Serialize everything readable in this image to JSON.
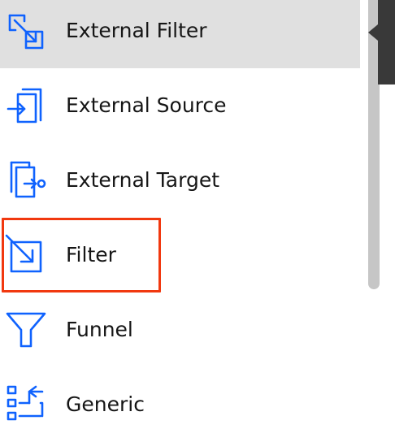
{
  "palette": {
    "icon": "#0f62fe",
    "selected_bg": "#e0e0e0",
    "highlight": "#f1380f",
    "flyout": "#393939"
  },
  "items": [
    {
      "label": "External Filter",
      "icon": "external-filter-icon",
      "selected": true
    },
    {
      "label": "External Source",
      "icon": "external-source-icon",
      "selected": false
    },
    {
      "label": "External Target",
      "icon": "external-target-icon",
      "selected": false
    },
    {
      "label": "Filter",
      "icon": "filter-icon",
      "selected": false,
      "highlighted": true
    },
    {
      "label": "Funnel",
      "icon": "funnel-icon",
      "selected": false
    },
    {
      "label": "Generic",
      "icon": "generic-icon",
      "selected": false
    }
  ]
}
